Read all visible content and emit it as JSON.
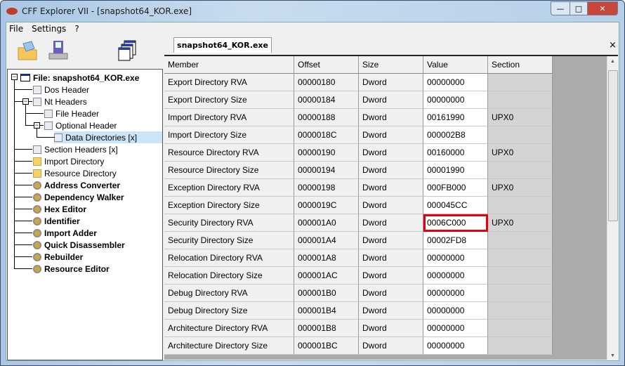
{
  "window": {
    "title": "CFF Explorer VII - [snapshot64_KOR.exe]",
    "minimize": "—",
    "maximize": "□",
    "close": "✕"
  },
  "menu": [
    "File",
    "Settings",
    "?"
  ],
  "toolbar": [
    {
      "icon": "open-folder-icon"
    },
    {
      "icon": "save-disk-icon"
    },
    {
      "icon": "windows-icon"
    }
  ],
  "tab": {
    "label": "snapshot64_KOR.exe",
    "close": "×"
  },
  "tree": [
    {
      "label": "File: snapshot64_KOR.exe",
      "icon": "window",
      "bold": true,
      "level": 0
    },
    {
      "label": "Dos Header",
      "icon": "doc",
      "level": 1
    },
    {
      "label": "Nt Headers",
      "icon": "doc",
      "level": 1
    },
    {
      "label": "File Header",
      "icon": "doc",
      "level": 2
    },
    {
      "label": "Optional Header",
      "icon": "doc",
      "level": 2
    },
    {
      "label": "Data Directories [x]",
      "icon": "doc",
      "level": 3,
      "selected": true
    },
    {
      "label": "Section Headers [x]",
      "icon": "doc",
      "level": 1
    },
    {
      "label": "Import Directory",
      "icon": "folder",
      "level": 1
    },
    {
      "label": "Resource Directory",
      "icon": "folder",
      "level": 1
    },
    {
      "label": "Address Converter",
      "icon": "gear",
      "bold": true,
      "level": 1
    },
    {
      "label": "Dependency Walker",
      "icon": "gear",
      "bold": true,
      "level": 1
    },
    {
      "label": "Hex Editor",
      "icon": "gear",
      "bold": true,
      "level": 1
    },
    {
      "label": "Identifier",
      "icon": "gear",
      "bold": true,
      "level": 1
    },
    {
      "label": "Import Adder",
      "icon": "gear",
      "bold": true,
      "level": 1
    },
    {
      "label": "Quick Disassembler",
      "icon": "gear",
      "bold": true,
      "level": 1
    },
    {
      "label": "Rebuilder",
      "icon": "gear",
      "bold": true,
      "level": 1
    },
    {
      "label": "Resource Editor",
      "icon": "gear",
      "bold": true,
      "level": 1
    }
  ],
  "table": {
    "columns": [
      "Member",
      "Offset",
      "Size",
      "Value",
      "Section"
    ],
    "rows": [
      [
        "Export Directory RVA",
        "00000180",
        "Dword",
        "00000000",
        ""
      ],
      [
        "Export Directory Size",
        "00000184",
        "Dword",
        "00000000",
        ""
      ],
      [
        "Import Directory RVA",
        "00000188",
        "Dword",
        "00161990",
        "UPX0"
      ],
      [
        "Import Directory Size",
        "0000018C",
        "Dword",
        "000002B8",
        ""
      ],
      [
        "Resource Directory RVA",
        "00000190",
        "Dword",
        "00160000",
        "UPX0"
      ],
      [
        "Resource Directory Size",
        "00000194",
        "Dword",
        "00001990",
        ""
      ],
      [
        "Exception Directory RVA",
        "00000198",
        "Dword",
        "000FB000",
        "UPX0"
      ],
      [
        "Exception Directory Size",
        "0000019C",
        "Dword",
        "000045CC",
        ""
      ],
      [
        "Security Directory RVA",
        "000001A0",
        "Dword",
        "0006C000",
        "UPX0"
      ],
      [
        "Security Directory Size",
        "000001A4",
        "Dword",
        "00002FD8",
        ""
      ],
      [
        "Relocation Directory RVA",
        "000001A8",
        "Dword",
        "00000000",
        ""
      ],
      [
        "Relocation Directory Size",
        "000001AC",
        "Dword",
        "00000000",
        ""
      ],
      [
        "Debug Directory RVA",
        "000001B0",
        "Dword",
        "00000000",
        ""
      ],
      [
        "Debug Directory Size",
        "000001B4",
        "Dword",
        "00000000",
        ""
      ],
      [
        "Architecture Directory RVA",
        "000001B8",
        "Dword",
        "00000000",
        ""
      ],
      [
        "Architecture Directory Size",
        "000001BC",
        "Dword",
        "00000000",
        ""
      ]
    ],
    "highlighted": {
      "row": 8,
      "column": 3,
      "color": "#e00010"
    }
  }
}
